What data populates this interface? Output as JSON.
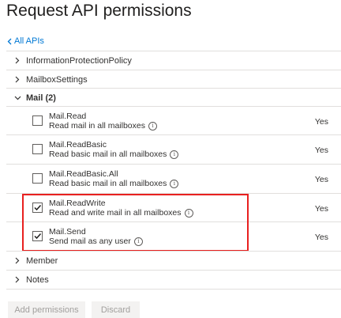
{
  "page": {
    "title": "Request API permissions"
  },
  "back_link": {
    "label": "All APIs"
  },
  "groups": {
    "information_protection": {
      "label": "InformationProtectionPolicy"
    },
    "mailbox_settings": {
      "label": "MailboxSettings"
    },
    "mail": {
      "label": "Mail (2)"
    },
    "member": {
      "label": "Member"
    },
    "notes": {
      "label": "Notes"
    }
  },
  "permissions": [
    {
      "name": "Mail.Read",
      "description": "Read mail in all mailboxes",
      "admin_consent": "Yes",
      "checked": false
    },
    {
      "name": "Mail.ReadBasic",
      "description": "Read basic mail in all mailboxes",
      "admin_consent": "Yes",
      "checked": false
    },
    {
      "name": "Mail.ReadBasic.All",
      "description": "Read basic mail in all mailboxes",
      "admin_consent": "Yes",
      "checked": false
    },
    {
      "name": "Mail.ReadWrite",
      "description": "Read and write mail in all mailboxes",
      "admin_consent": "Yes",
      "checked": true
    },
    {
      "name": "Mail.Send",
      "description": "Send mail as any user",
      "admin_consent": "Yes",
      "checked": true
    }
  ],
  "footer": {
    "add_permissions_label": "Add permissions",
    "discard_label": "Discard"
  },
  "colors": {
    "accent": "#0078d4",
    "highlight": "#e8201f",
    "disabled_text": "#a19f9d"
  },
  "icons": {
    "back": "chevron-left-icon",
    "collapsed": "chevron-right-icon",
    "expanded": "chevron-down-icon",
    "info": "info-icon",
    "check": "checkmark-icon"
  }
}
